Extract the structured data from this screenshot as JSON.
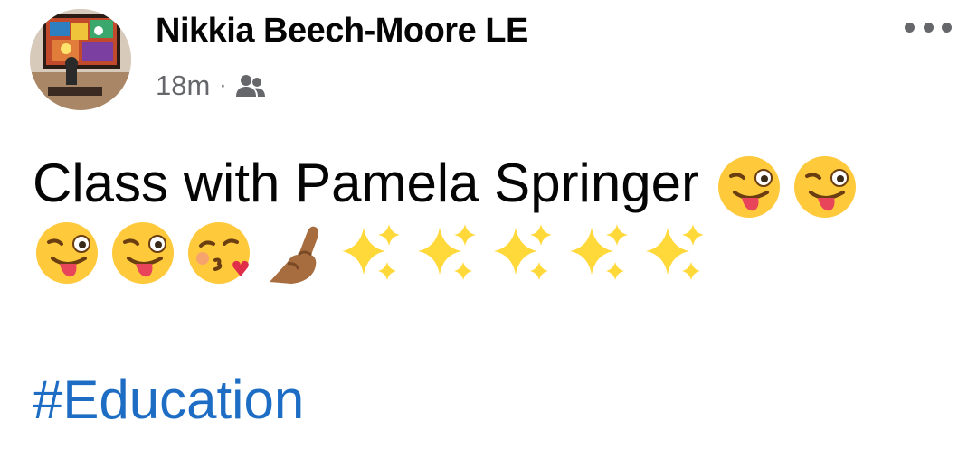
{
  "post": {
    "author": "Nikkia Beech-Moore LE",
    "time": "18m",
    "separator": "·",
    "audience_icon": "friends-icon",
    "more_icon": "more-options-icon",
    "message_text": "Class with Pamela Springer",
    "emojis_line1": [
      "winking-face-with-tongue",
      "winking-face-with-tongue"
    ],
    "emojis_line2": [
      "winking-face-with-tongue",
      "winking-face-with-tongue",
      "face-blowing-a-kiss",
      "pinched-fingers-medium-dark-skin",
      "sparkles",
      "sparkles",
      "sparkles",
      "sparkles",
      "sparkles"
    ],
    "hashtag": "#Education"
  },
  "colors": {
    "text": "#050505",
    "meta": "#65676b",
    "link": "#1e6dc4",
    "emoji_yellow": "#ffc93c",
    "sparkle": "#ffd83a"
  }
}
